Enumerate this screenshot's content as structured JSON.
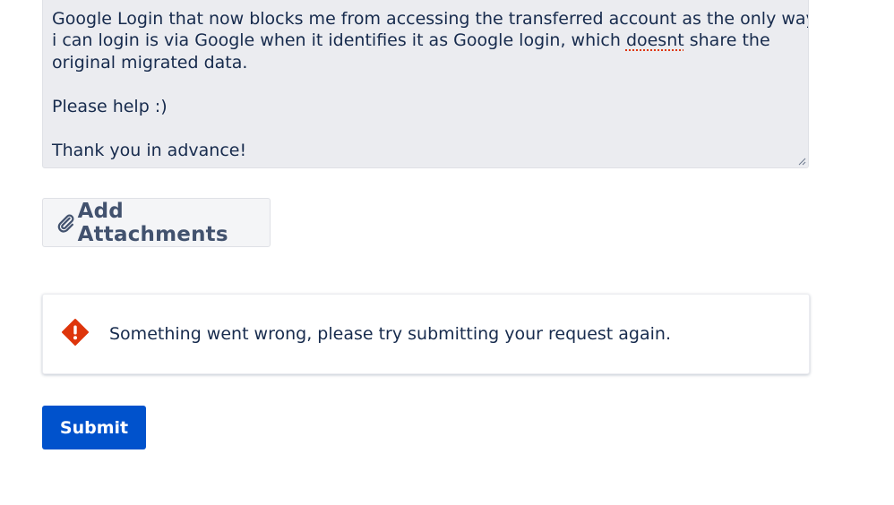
{
  "description_field": {
    "line_cut": "……………………………………",
    "line1": "Google Login that now blocks me from accessing the transferred account as the only way",
    "line2_before": "i can login is via Google when it identifies it as Google login, which ",
    "line2_misspelled": "doesnt",
    "line2_after": " share the",
    "line3": "original migrated data.",
    "line4": "Please help :)",
    "line5": "Thank you in advance!"
  },
  "attachments": {
    "button_label": "Add Attachments",
    "icon": "paperclip-icon"
  },
  "alert": {
    "icon": "error-diamond-icon",
    "message": "Something went wrong, please try submitting your request again.",
    "icon_color": "#de350b"
  },
  "submit": {
    "label": "Submit",
    "color": "#0052cc"
  }
}
